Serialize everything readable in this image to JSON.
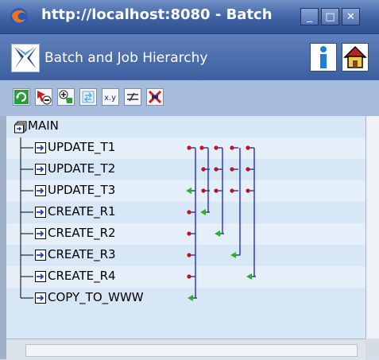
{
  "window": {
    "title": "http://localhost:8080 - Batch",
    "minimize_glyph": "_",
    "maximize_glyph": "□",
    "close_glyph": "✕"
  },
  "header": {
    "title": "Batch and Job Hierarchy",
    "info_icon": "info-icon",
    "home_icon": "home-icon"
  },
  "toolbar": {
    "tools": [
      {
        "name": "refresh-tool",
        "glyph": "↻"
      },
      {
        "name": "remove-tool",
        "glyph": "⊖"
      },
      {
        "name": "add-tool",
        "glyph": "⊕"
      },
      {
        "name": "move-tool",
        "glyph": "⇄"
      },
      {
        "name": "xy-tool",
        "glyph": "x.y"
      },
      {
        "name": "switch-tool",
        "glyph": "⇆"
      },
      {
        "name": "delete-tool",
        "glyph": "✖"
      }
    ]
  },
  "tree": {
    "root": "MAIN",
    "jobs": [
      "UPDATE_T1",
      "UPDATE_T2",
      "UPDATE_T3",
      "CREATE_R1",
      "CREATE_R2",
      "CREATE_R3",
      "CREATE_R4",
      "COPY_TO_WWW"
    ]
  },
  "colors": {
    "dependency_line": "#2a2fb0",
    "predecessor_dot": "#c0112a",
    "successor_arrow": "#2fae2f"
  }
}
